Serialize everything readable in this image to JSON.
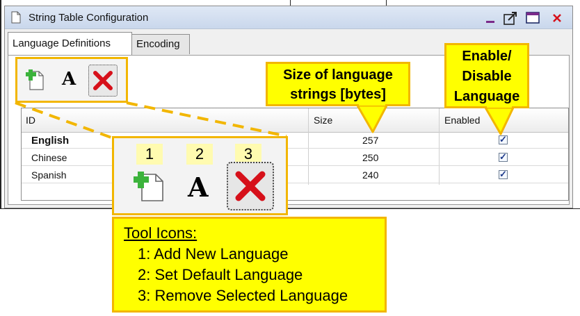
{
  "window": {
    "title": "String Table Configuration",
    "tabs": [
      {
        "label": "Language Definitions",
        "active": true
      },
      {
        "label": "Encoding",
        "active": false
      }
    ]
  },
  "table": {
    "columns": [
      "ID",
      "Size",
      "Enabled"
    ],
    "rows": [
      {
        "id": "English",
        "size": "257",
        "enabled": true,
        "bold": true
      },
      {
        "id": "Chinese",
        "size": "250",
        "enabled": true,
        "bold": false
      },
      {
        "id": "Spanish",
        "size": "240",
        "enabled": true,
        "bold": false
      }
    ]
  },
  "callouts": {
    "size": [
      "Size of language",
      "strings [bytes]"
    ],
    "enable": [
      "Enable/",
      "Disable",
      "Language"
    ],
    "numbers": [
      "1",
      "2",
      "3"
    ],
    "tool_icons": {
      "heading": "Tool Icons:",
      "items": [
        "1: Add New Language",
        "2: Set Default Language",
        "3: Remove Selected Language"
      ]
    }
  },
  "icons": {
    "add": "add-language-icon",
    "font": "A",
    "remove": "remove-language-icon"
  },
  "colors": {
    "callout_fill": "#ffff00",
    "callout_border": "#f2b600",
    "remove_red": "#d6101a",
    "add_green": "#3cb33c"
  }
}
